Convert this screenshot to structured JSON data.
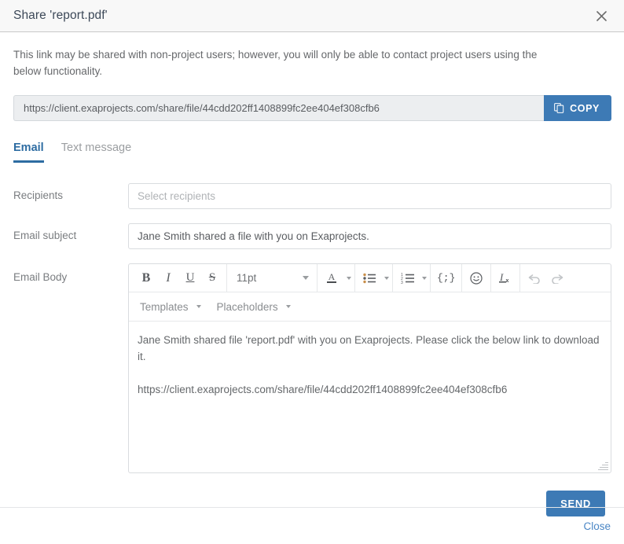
{
  "header": {
    "title": "Share 'report.pdf'",
    "close_icon": "close-icon"
  },
  "intro": {
    "text": "This link may be shared with non-project users; however, you will only be able to contact project users using the below functionality."
  },
  "share_link": {
    "url": "https://client.exaprojects.com/share/file/44cdd202ff1408899fc2ee404ef308cfb6",
    "copy_label": "COPY",
    "copy_icon": "copy-icon",
    "accent_color": "#3d7ab5"
  },
  "tabs": [
    {
      "label": "Email",
      "active": true
    },
    {
      "label": "Text message",
      "active": false
    }
  ],
  "form": {
    "recipients": {
      "label": "Recipients",
      "value": "",
      "placeholder": "Select recipients"
    },
    "subject": {
      "label": "Email subject",
      "value": "Jane Smith shared a file with you on Exaprojects.",
      "placeholder": ""
    },
    "body": {
      "label": "Email Body",
      "paragraph1": "Jane Smith shared file 'report.pdf' with you on Exaprojects. Please click the below link to download it.",
      "paragraph2": "https://client.exaprojects.com/share/file/44cdd202ff1408899fc2ee404ef308cfb6"
    }
  },
  "editor_toolbar": {
    "bold": "B",
    "italic": "I",
    "underline": "U",
    "strikethrough": "S",
    "font_size": "11pt",
    "code_label": "{;}",
    "icons": {
      "text_color": "text-color-icon",
      "bullet_list": "bullet-list-icon",
      "numbered_list": "numbered-list-icon",
      "code": "code-icon",
      "emoji": "emoji-icon",
      "clear_format": "clear-formatting-icon",
      "undo": "undo-icon",
      "redo": "redo-icon"
    },
    "templates_label": "Templates",
    "placeholders_label": "Placeholders"
  },
  "actions": {
    "send_label": "SEND",
    "close_label": "Close"
  }
}
